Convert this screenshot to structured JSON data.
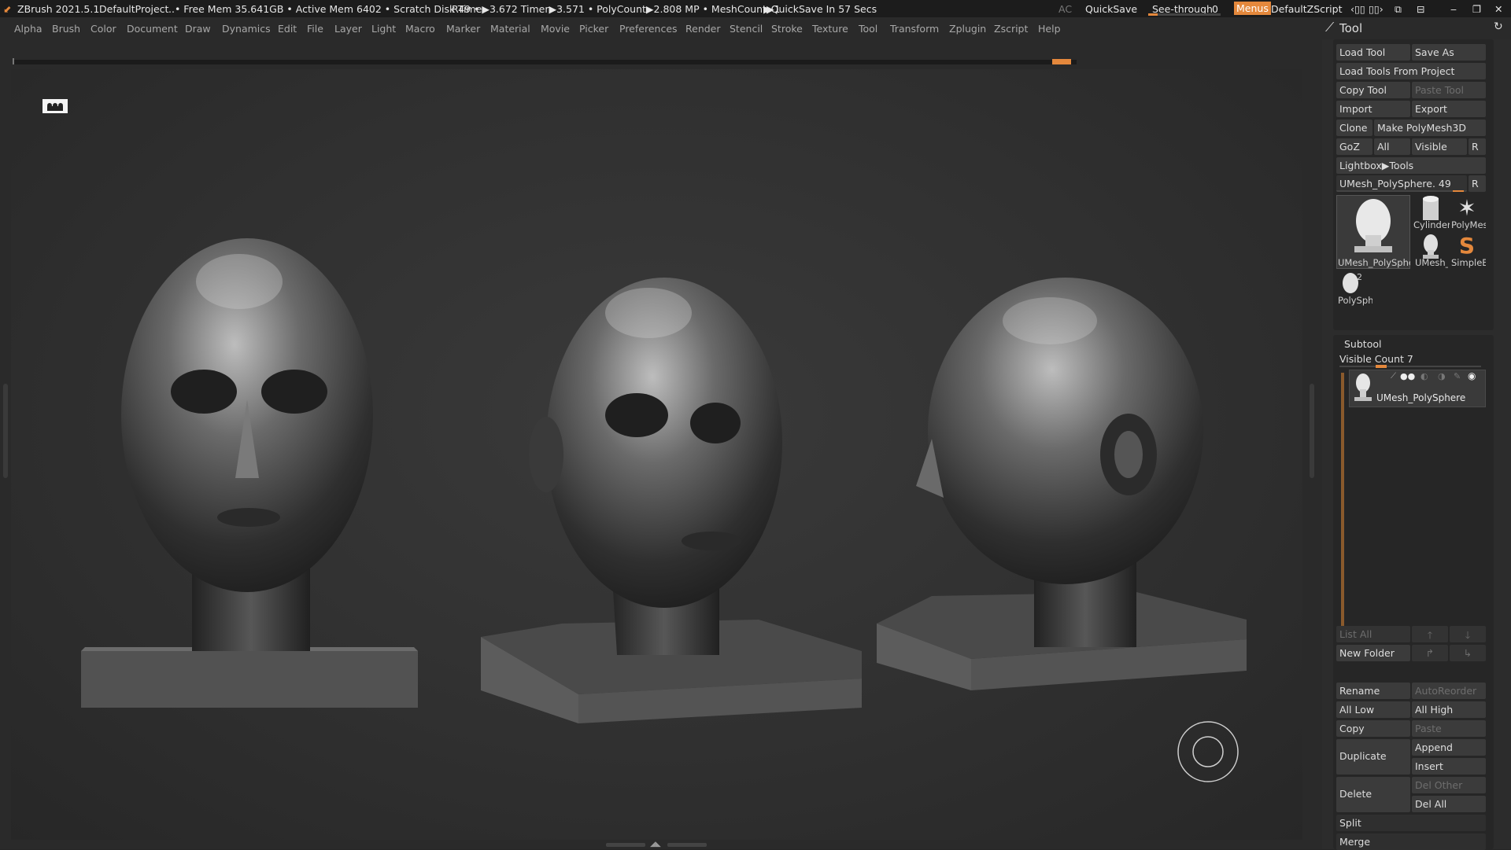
{
  "titlebar": {
    "app": "ZBrush 2021.5.1",
    "project": "DefaultProject",
    "status": "..• Free Mem 35.641GB • Active Mem 6402 • Scratch Disk 49 •",
    "stats": "RTime▶3.672 Timer▶3.571 • PolyCount▶2.808 MP • MeshCount▶1",
    "quicksave_timer": "▶QuickSave In 57 Secs",
    "ac": "AC",
    "quicksave": "QuickSave",
    "seethrough_label": "See-through",
    "seethrough_value": "0",
    "menus": "Menus",
    "script": "DefaultZScript"
  },
  "menu": [
    "Alpha",
    "Brush",
    "Color",
    "Document",
    "Draw",
    "Dynamics",
    "Edit",
    "File",
    "Layer",
    "Light",
    "Macro",
    "Marker",
    "Material",
    "Movie",
    "Picker",
    "Preferences",
    "Render",
    "Stencil",
    "Stroke",
    "Texture",
    "Tool",
    "Transform",
    "Zplugin",
    "Zscript",
    "Help"
  ],
  "tool_panel": {
    "title": "Tool",
    "load_tool": "Load Tool",
    "save_as": "Save As",
    "load_from_project": "Load Tools From Project",
    "copy_tool": "Copy Tool",
    "paste_tool": "Paste Tool",
    "import": "Import",
    "export": "Export",
    "clone": "Clone",
    "make_polymesh": "Make PolyMesh3D",
    "goz": "GoZ",
    "all": "All",
    "visible": "Visible",
    "r": "R",
    "lightbox": "Lightbox▶Tools",
    "current_tool": "UMesh_PolySphere. 49",
    "thumbs": {
      "main": "UMesh_PolySphe",
      "cylinder": "Cylinder",
      "polymesh": "PolyMes",
      "umesh_small": "UMesh_",
      "simpleb": "SimpleB",
      "polysph": "PolySph",
      "polysph_count": "2"
    }
  },
  "subtool": {
    "title": "Subtool",
    "visible_count": "Visible Count 7",
    "item_name": "UMesh_PolySphere",
    "list_all": "List All",
    "new_folder": "New Folder",
    "rename": "Rename",
    "autoreorder": "AutoReorder",
    "all_low": "All Low",
    "all_high": "All High",
    "copy": "Copy",
    "paste": "Paste",
    "duplicate": "Duplicate",
    "append": "Append",
    "insert": "Insert",
    "delete": "Delete",
    "del_other": "Del Other",
    "del_all": "Del All",
    "split": "Split",
    "merge": "Merge"
  },
  "colors": {
    "accent": "#e4883c",
    "panel": "#2c2c2c",
    "button": "#3b3b3b"
  }
}
